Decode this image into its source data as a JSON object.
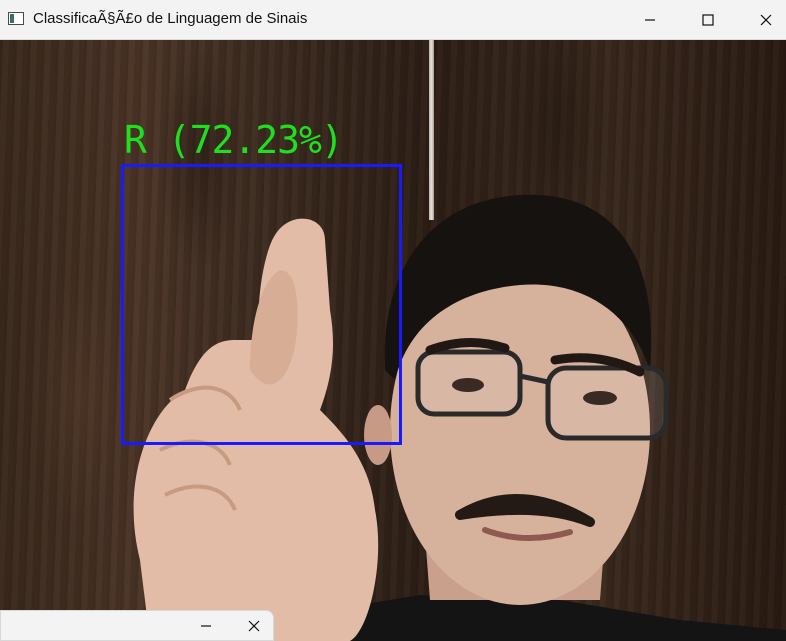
{
  "window": {
    "title": "ClassificaÃ§Ã£o de Linguagem de Sinais",
    "icon": "window-app-icon",
    "controls": [
      "minimize-icon",
      "maximize-icon",
      "close-icon"
    ]
  },
  "detection": {
    "label": "R (72.23%)",
    "letter": "R",
    "confidence_percent": 72.23,
    "box_color": "#1a1aff",
    "text_color": "#1ee01e"
  },
  "second_window": {
    "controls": [
      "minimize-icon",
      "close-icon"
    ]
  }
}
